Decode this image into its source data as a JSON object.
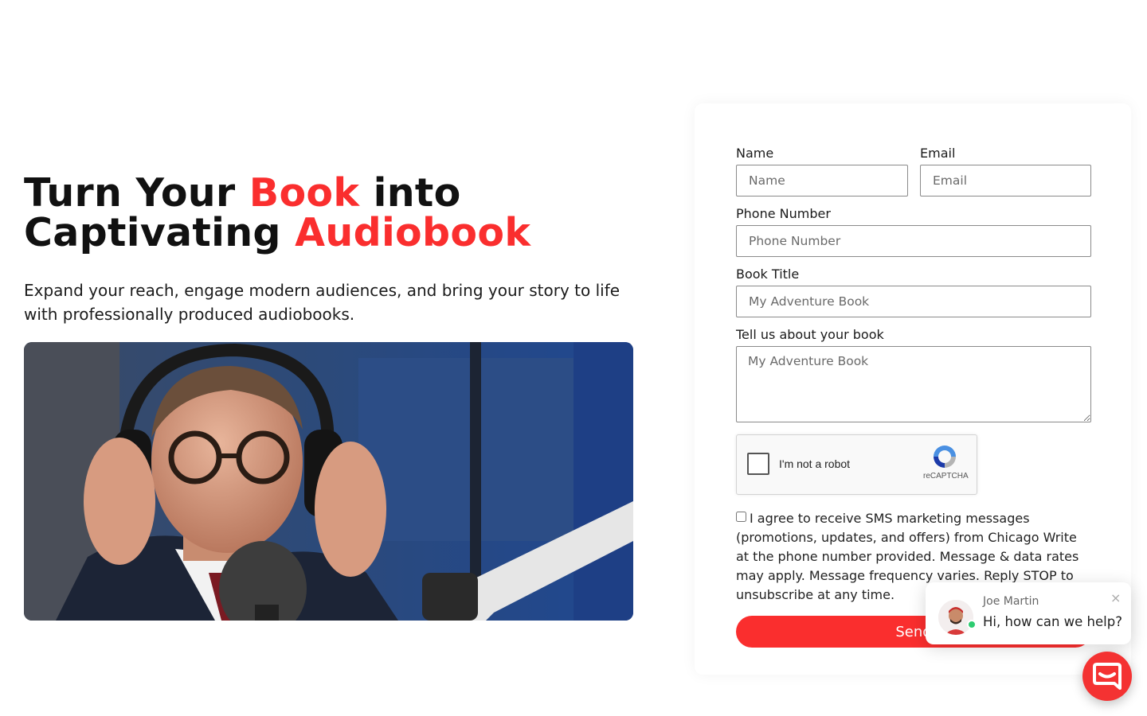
{
  "hero": {
    "title_part1": "Turn Your ",
    "title_accent1": "Book",
    "title_part2": " into",
    "title_part3": "Captivating ",
    "title_accent2": "Audiobook",
    "subtitle": "Expand your reach, engage modern audiences, and bring your story to life with professionally produced audiobooks."
  },
  "form": {
    "name_label": "Name",
    "name_placeholder": "Name",
    "email_label": "Email",
    "email_placeholder": "Email",
    "phone_label": "Phone Number",
    "phone_placeholder": "Phone Number",
    "book_title_label": "Book Title",
    "book_title_placeholder": "My Adventure Book",
    "about_label": "Tell us about your book",
    "about_placeholder": "My Adventure Book",
    "captcha_text": "I'm not a robot",
    "captcha_brand": "reCAPTCHA",
    "consent_text": "I agree to receive SMS marketing messages (promotions, updates, and offers) from Chicago Write at the phone number provided. Message & data rates may apply. Message frequency varies. Reply STOP to unsubscribe at any time.",
    "send_label": "Send"
  },
  "chat": {
    "agent_name": "Joe Martin",
    "message": "Hi, how can we help?",
    "close_icon": "×"
  },
  "colors": {
    "accent": "#fa2e2e",
    "online": "#2ecc71"
  },
  "icons": {
    "captcha": "recaptcha-icon",
    "chat": "chat-bubble-icon",
    "close": "close-icon"
  }
}
